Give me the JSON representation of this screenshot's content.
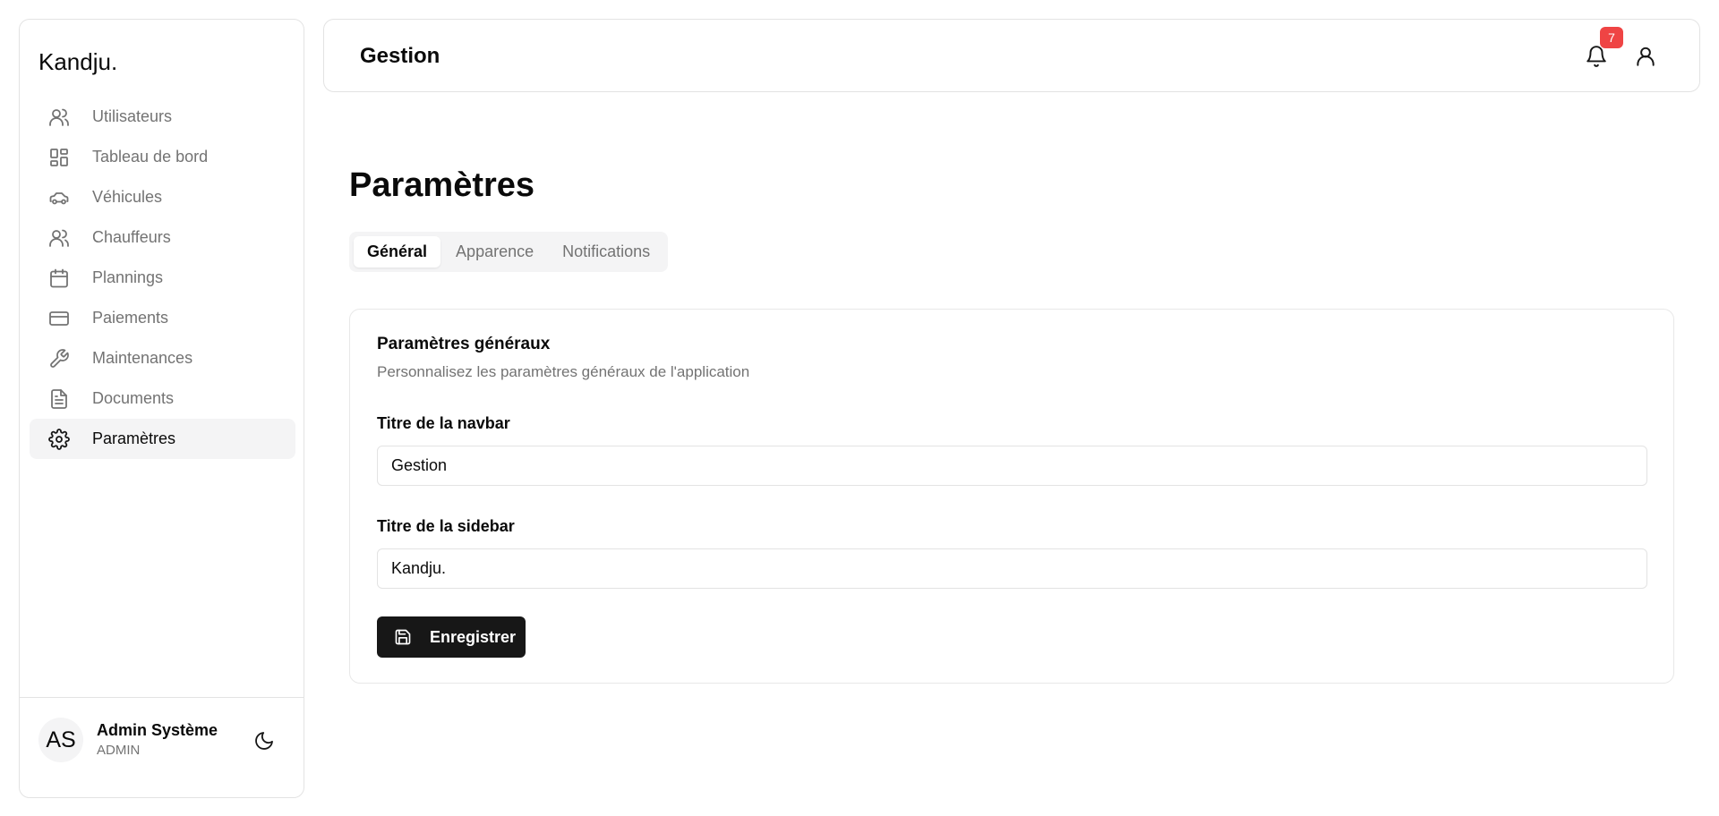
{
  "sidebar": {
    "brand": "Kandju.",
    "items": [
      {
        "label": "Utilisateurs",
        "icon": "users-icon"
      },
      {
        "label": "Tableau de bord",
        "icon": "dashboard-icon"
      },
      {
        "label": "Véhicules",
        "icon": "car-icon"
      },
      {
        "label": "Chauffeurs",
        "icon": "users-icon"
      },
      {
        "label": "Plannings",
        "icon": "calendar-icon"
      },
      {
        "label": "Paiements",
        "icon": "credit-card-icon"
      },
      {
        "label": "Maintenances",
        "icon": "wrench-icon"
      },
      {
        "label": "Documents",
        "icon": "document-icon"
      },
      {
        "label": "Paramètres",
        "icon": "settings-gear-icon",
        "active": true
      }
    ],
    "user": {
      "initials": "AS",
      "name": "Admin Système",
      "role": "ADMIN"
    }
  },
  "topbar": {
    "title": "Gestion",
    "notification_count": "7"
  },
  "main": {
    "page_title": "Paramètres",
    "tabs": [
      {
        "label": "Général",
        "active": true
      },
      {
        "label": "Apparence"
      },
      {
        "label": "Notifications"
      }
    ],
    "card": {
      "title": "Paramètres généraux",
      "description": "Personnalisez les paramètres généraux de l'application",
      "navbar_title_label": "Titre de la navbar",
      "navbar_title_value": "Gestion",
      "sidebar_title_label": "Titre de la sidebar",
      "sidebar_title_value": "Kandju.",
      "save_label": "Enregistrer"
    }
  },
  "colors": {
    "accent": "#171717",
    "badge": "#ef4444",
    "muted_text": "#737373",
    "border": "#e3e3e3",
    "active_bg": "#f4f4f5"
  }
}
